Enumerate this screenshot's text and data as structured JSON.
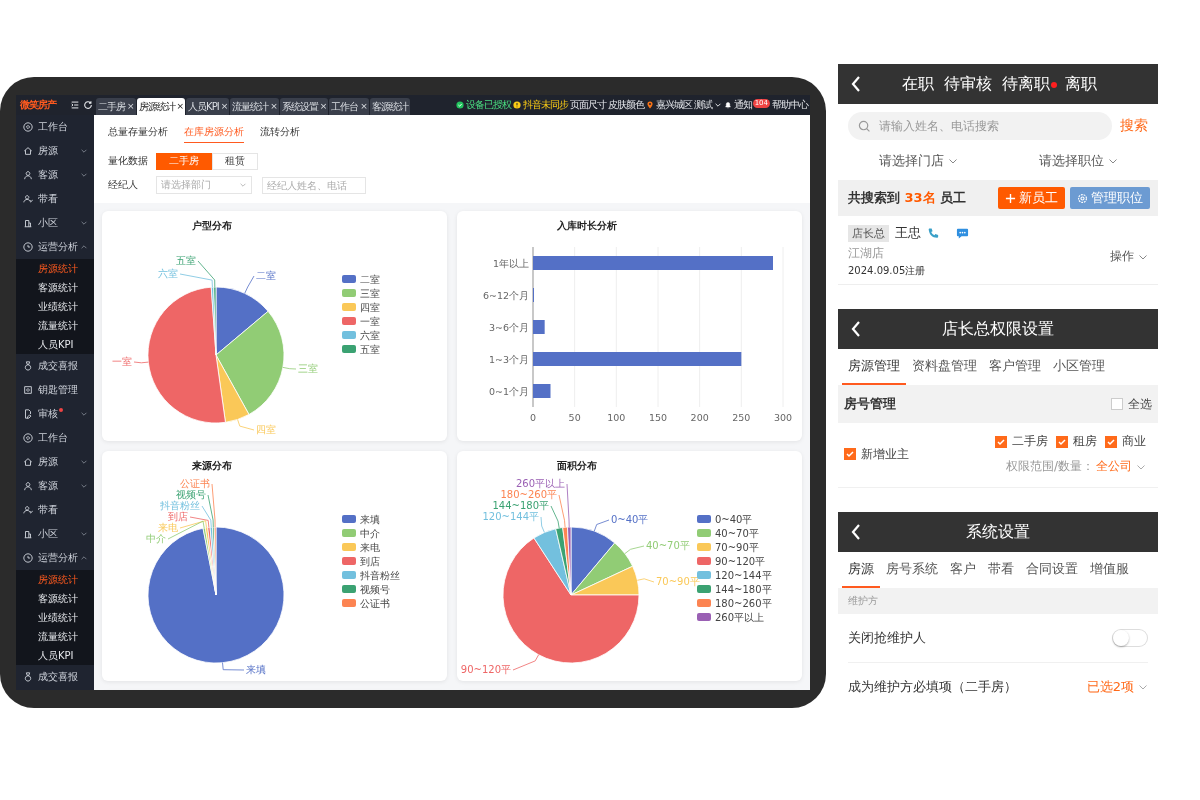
{
  "tablet": {
    "topbar": {
      "logo": "微笑房产",
      "tabs": [
        {
          "label": "二手房",
          "selected": false,
          "close": "×"
        },
        {
          "label": "房源统计",
          "selected": true,
          "close": "×"
        },
        {
          "label": "人员KPI",
          "selected": false,
          "close": "×"
        },
        {
          "label": "流量统计",
          "selected": false,
          "close": "×"
        },
        {
          "label": "系统设置",
          "selected": false,
          "close": "×"
        },
        {
          "label": "工作台",
          "selected": false,
          "close": "×"
        },
        {
          "label": "客源统计",
          "selected": false
        }
      ],
      "items": [
        {
          "kind": "ok",
          "label": "设备已授权"
        },
        {
          "kind": "warn",
          "label": "抖音未同步"
        },
        {
          "kind": "plain",
          "label": "页面尺寸"
        },
        {
          "kind": "plain",
          "label": "皮肤颜色"
        },
        {
          "kind": "location",
          "label": "嘉兴城区"
        },
        {
          "kind": "dropdown",
          "label": "测试"
        },
        {
          "kind": "notify",
          "label": "通知",
          "badge": "104"
        },
        {
          "kind": "plain",
          "label": "帮助中心"
        }
      ]
    },
    "sidebar": [
      {
        "label": "工作台",
        "alert": false
      },
      {
        "label": "房源",
        "alert": false,
        "expanded": false
      },
      {
        "label": "客源",
        "alert": false,
        "expanded": false
      },
      {
        "label": "带看",
        "alert": false
      },
      {
        "label": "小区",
        "alert": false,
        "expanded": false
      },
      {
        "label": "运营分析",
        "alert": false,
        "expanded": true,
        "children": [
          {
            "label": "房源统计",
            "selected": true
          },
          {
            "label": "客源统计",
            "selected": false
          },
          {
            "label": "业绩统计",
            "selected": false
          },
          {
            "label": "流量统计",
            "selected": false
          },
          {
            "label": "人员KPI",
            "selected": false
          }
        ]
      },
      {
        "label": "成交喜报",
        "alert": false
      },
      {
        "label": "钥匙管理",
        "alert": false
      },
      {
        "label": "审核",
        "alert": true,
        "expanded": false
      },
      {
        "label": "工作台",
        "alert": false
      },
      {
        "label": "房源",
        "alert": false,
        "expanded": false
      },
      {
        "label": "客源",
        "alert": false,
        "expanded": false
      },
      {
        "label": "带看",
        "alert": false
      },
      {
        "label": "小区",
        "alert": false,
        "expanded": false
      },
      {
        "label": "运营分析",
        "alert": false,
        "expanded": true,
        "children": [
          {
            "label": "房源统计",
            "selected": true
          },
          {
            "label": "客源统计",
            "selected": false
          },
          {
            "label": "业绩统计",
            "selected": false
          },
          {
            "label": "流量统计",
            "selected": false
          },
          {
            "label": "人员KPI",
            "selected": false
          }
        ]
      },
      {
        "label": "成交喜报",
        "alert": false
      }
    ],
    "page_tabs": [
      {
        "label": "总量存量分析",
        "selected": false
      },
      {
        "label": "在库房源分析",
        "selected": true
      },
      {
        "label": "流转分析",
        "selected": false
      }
    ],
    "quantify": {
      "label": "量化数据",
      "options": [
        {
          "label": "二手房",
          "selected": true
        },
        {
          "label": "租赁",
          "selected": false
        }
      ]
    },
    "agent_filter": {
      "label": "经纪人",
      "department": {
        "placeholder": "请选择部门"
      },
      "search": {
        "placeholder": "经纪人姓名、电话"
      }
    },
    "cards": [
      {
        "kind": "pie",
        "title": "户型分布",
        "slice_labels": [
          "五室",
          "六室",
          "二室",
          "一室",
          "三室",
          "四室"
        ],
        "legend": [
          {
            "label": "二室",
            "color": "#5470c6"
          },
          {
            "label": "三室",
            "color": "#91cc75"
          },
          {
            "label": "四室",
            "color": "#fac858"
          },
          {
            "label": "一室",
            "color": "#ee6666"
          },
          {
            "label": "六室",
            "color": "#73c0de"
          },
          {
            "label": "五室",
            "color": "#3ba272"
          }
        ]
      },
      {
        "kind": "bar",
        "title": "入库时长分析",
        "chart_data": {
          "type": "bar",
          "orientation": "horizontal",
          "categories": [
            "1年以上",
            "6~12个月",
            "3~6个月",
            "1~3个月",
            "0~1个月"
          ],
          "series": [
            {
              "color": "#5470c6",
              "values": [
                288,
                1,
                14,
                250,
                21
              ]
            }
          ],
          "xlim": [
            0,
            300
          ],
          "xticks": [
            0,
            50,
            100,
            150,
            200,
            250,
            300
          ],
          "grid": true
        }
      },
      {
        "kind": "pie",
        "title": "来源分布",
        "slice_labels": [
          "公证书",
          "视频号",
          "抖音粉丝",
          "到店",
          "来电",
          "中介",
          "来填"
        ],
        "legend": [
          {
            "label": "来填",
            "color": "#5470c6"
          },
          {
            "label": "中介",
            "color": "#91cc75"
          },
          {
            "label": "来电",
            "color": "#fac858"
          },
          {
            "label": "到店",
            "color": "#ee6666"
          },
          {
            "label": "抖音粉丝",
            "color": "#73c0de"
          },
          {
            "label": "视频号",
            "color": "#3ba272"
          },
          {
            "label": "公证书",
            "color": "#fc8452"
          }
        ]
      },
      {
        "kind": "pie",
        "title": "面积分布",
        "slice_labels": [
          "260平以上",
          "180~260平",
          "144~180平",
          "120~144平",
          "0~40平",
          "40~70平",
          "70~90平",
          "90~120平"
        ],
        "legend": [
          {
            "label": "0~40平",
            "color": "#5470c6"
          },
          {
            "label": "40~70平",
            "color": "#91cc75"
          },
          {
            "label": "70~90平",
            "color": "#fac858"
          },
          {
            "label": "90~120平",
            "color": "#ee6666"
          },
          {
            "label": "120~144平",
            "color": "#73c0de"
          },
          {
            "label": "144~180平",
            "color": "#3ba272"
          },
          {
            "label": "180~260平",
            "color": "#fc8452"
          },
          {
            "label": "260平以上",
            "color": "#9a60b4"
          }
        ]
      },
      {
        "kind": "empty"
      },
      {
        "kind": "empty"
      }
    ]
  },
  "staff_screen": {
    "tabs": [
      {
        "label": "在职",
        "dot": false
      },
      {
        "label": "待审核",
        "dot": false
      },
      {
        "label": "待离职",
        "dot": true
      },
      {
        "label": "离职",
        "dot": false
      }
    ],
    "search": {
      "placeholder": "请输入姓名、电话搜索",
      "button": "搜索"
    },
    "filters": [
      "请选择门店",
      "请选择职位"
    ],
    "summary": "共搜索到 **33名** 员工",
    "add_button": "新员工",
    "roles_button": "管理职位",
    "employees": [
      {
        "role": "店长总",
        "name": "王忠",
        "store": "江湖店",
        "registered": "2024.09.05注册",
        "action": "操作"
      }
    ]
  },
  "permission_screen": {
    "title": "店长总权限设置",
    "tabs": [
      {
        "label": "房源管理",
        "selected": true
      },
      {
        "label": "资料盘管理",
        "selected": false
      },
      {
        "label": "客户管理",
        "selected": false
      },
      {
        "label": "小区管理",
        "selected": false
      }
    ],
    "section": {
      "title": "房号管理",
      "select_all": {
        "label": "全选",
        "checked": false
      }
    },
    "rows": [
      {
        "label": "新增业主",
        "checked": true,
        "options": [
          {
            "label": "二手房",
            "checked": true
          },
          {
            "label": "租房",
            "checked": true
          },
          {
            "label": "商业",
            "checked": true
          }
        ],
        "scope_label": "权限范围/数量：",
        "scope_value": "全公司"
      }
    ]
  },
  "settings_screen": {
    "title": "系统设置",
    "tabs": [
      {
        "label": "房源",
        "selected": true
      },
      {
        "label": "房号系统",
        "selected": false
      },
      {
        "label": "客户",
        "selected": false
      },
      {
        "label": "带看",
        "selected": false
      },
      {
        "label": "合同设置",
        "selected": false
      },
      {
        "label": "增值服",
        "selected": false
      }
    ],
    "group": "维护方",
    "rows": [
      {
        "kind": "toggle",
        "label": "关闭抢维护人",
        "on": false
      },
      {
        "kind": "select",
        "label": "成为维护方必填项（二手房）",
        "value": "已选2项"
      }
    ]
  }
}
